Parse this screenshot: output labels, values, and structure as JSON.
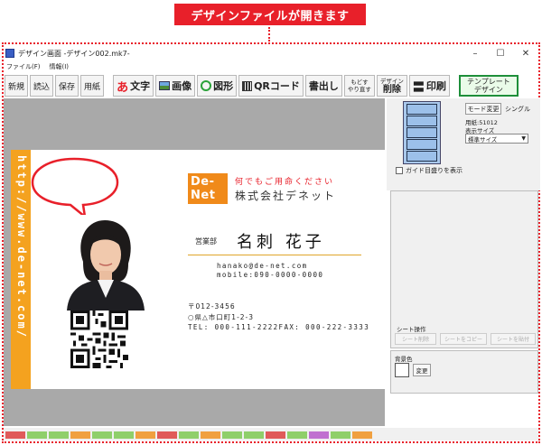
{
  "callout": "デザインファイルが開きます",
  "window": {
    "title": "デザイン画面 -デザイン002.mk7-",
    "minimize": "–",
    "maximize": "☐",
    "close": "✕"
  },
  "menu": [
    "ファイル(F)",
    "情報(I)"
  ],
  "toolbar": {
    "new": "新規",
    "read": "読込",
    "save": "保存",
    "paper": "用紙",
    "text_icon": "あ",
    "text": "文字",
    "image": "画像",
    "shape": "図形",
    "qr": "QRコード",
    "export": "書出し",
    "redo_1": "もどす",
    "redo_2": "やり直す",
    "delete_1": "デザイン",
    "delete_2": "削除",
    "print_icon": "〓",
    "print": "印刷",
    "template_1": "テンプレート",
    "template_2": "デザイン"
  },
  "card": {
    "url": "http://www.de-net.com/",
    "logo_1": "De-",
    "logo_2": "Net",
    "tagline": "何でもご用命ください",
    "company": "株式会社デネット",
    "dept": "営業部",
    "name": "名刺 花子",
    "email": "hanako@de-net.com",
    "mobile": "mobile:090-0000-0000",
    "zip": "〒012-3456",
    "address": "○県△市口町1-2-3",
    "tel": "TEL: 000-111-2222FAX: 000-222-3333"
  },
  "side": {
    "mode_button": "モード変更",
    "single": "シングル",
    "paper_code": "用紙:51012",
    "display_size_label": "表示サイズ",
    "display_size_value": "標準サイズ",
    "guide_label": "ガイド目盛りを表示",
    "sheet_label": "シート操作",
    "sheet_delete": "シート削除",
    "sheet_copy": "シートをコピー",
    "sheet_paste": "シートを貼付",
    "bg_label": "背景色",
    "bg_change": "変更"
  },
  "colors": {
    "accent_red": "#e8202a",
    "orange": "#f4a21f",
    "template_green": "#1e8f3a"
  }
}
